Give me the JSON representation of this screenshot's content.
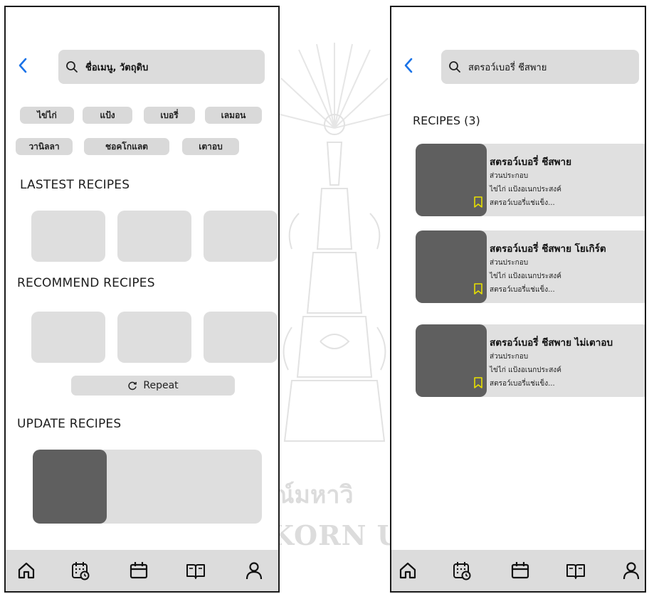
{
  "colors": {
    "accent": "#1a73e8",
    "card": "#dedede",
    "thumb": "#5f5f5f",
    "nav_bg": "#dcdcdc",
    "bookmark": "#e8e000"
  },
  "watermark": {
    "thai_text": "ณ์มหาวิ",
    "latin_text": "KORN UN"
  },
  "left_screen": {
    "search": {
      "placeholder": "ชื่อเมนู, วัตถุดิบ"
    },
    "chips": [
      "ไข่ไก่",
      "แป้ง",
      "เบอรี่",
      "เลมอน",
      "วานิลลา",
      "ชอคโกแลต",
      "เตาอบ"
    ],
    "sections": {
      "latest": "LASTEST RECIPES",
      "recommend": "RECOMMEND RECIPES",
      "update": "UPDATE RECIPES"
    },
    "repeat_label": "Repeat",
    "nav": [
      "home-icon",
      "calendar-clock-icon",
      "calendar-icon",
      "book-icon",
      "user-icon"
    ]
  },
  "right_screen": {
    "search": {
      "query": "สตรอว์เบอรี่ ชีสพาย"
    },
    "results_title": "RECIPES (3)",
    "recipes": [
      {
        "name": "สตรอว์เบอรี่ ชีสพาย",
        "line1": "ส่วนประกอบ",
        "line2": "ไข่ไก่ แป้งอเนกประสงค์",
        "line3": "สตรอว์เบอรี่แช่แข็ง..."
      },
      {
        "name": "สตรอว์เบอรี่ ชีสพาย โยเกิร์ต",
        "line1": "ส่วนประกอบ",
        "line2": "ไข่ไก่ แป้งอเนกประสงค์",
        "line3": "สตรอว์เบอรี่แช่แข็ง..."
      },
      {
        "name": "สตรอว์เบอรี่ ชีสพาย ไม่เตาอบ",
        "line1": "ส่วนประกอบ",
        "line2": "ไข่ไก่ แป้งอเนกประสงค์",
        "line3": "สตรอว์เบอรี่แช่แข็ง..."
      }
    ],
    "nav": [
      "home-icon",
      "calendar-clock-icon",
      "calendar-icon",
      "book-icon",
      "user-icon"
    ]
  }
}
